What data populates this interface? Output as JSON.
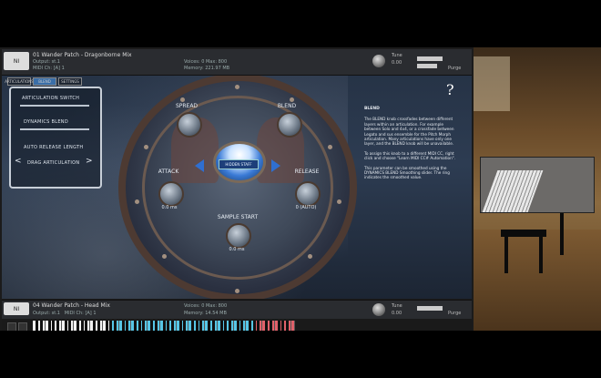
{
  "instrument_top": {
    "logo": "NI",
    "title": "01 Wander Patch - Dragonborne Mix",
    "output_label": "Output:",
    "output_value": "st.1",
    "midi_label": "MIDI Ch:",
    "midi_value": "[A] 1",
    "voices_label": "Voices:",
    "voices_value": "0",
    "max_label": "Max:",
    "max_value": "800",
    "memory_label": "Memory:",
    "memory_value": "221.97 MB",
    "tune_label": "Tune",
    "tune_value": "0.00",
    "purge_label": "Purge"
  },
  "tabs": [
    "ARTICULATIONS",
    "BLEND",
    "SETTINGS"
  ],
  "left_panel": {
    "title": "ARTICULATION SWITCH",
    "label2": "DYNAMICS BLEND",
    "label3": "AUTO RELEASE LENGTH",
    "label4": "DRAG ARTICULATION",
    "arrow_left": "<",
    "arrow_right": ">"
  },
  "shield": {
    "dial_top_left": "SPREAD",
    "dial_top_right": "BLEND",
    "dial_left": "ATTACK",
    "dial_left_value": "0.0 ms",
    "dial_right": "RELEASE",
    "dial_right_value": "0 (AUTO)",
    "dial_bottom": "SAMPLE START",
    "dial_bottom_value": "0.0 ms",
    "center_button": "HIDDEN STAFF"
  },
  "info": {
    "title": "BLEND",
    "p1": "The BLEND knob crossfades between different layers within an articulation. For example between Solo and 4x4, or a crossfade between Legato and sus ensemble for the Pitch Morph articulation. Many articulations have only one layer, and the BLEND knob will be unavailable.",
    "p2": "To assign this knob to a different MIDI CC, right click and choose \"Learn MIDI CC# Automation\".",
    "p3": "This parameter can be smoothed using the DYNAMICS BLEND Smoothing slider. The ring indicates the smoothed value.",
    "help": "?"
  },
  "instrument_bottom": {
    "logo": "NI",
    "title": "04 Wander Patch - Head Mix",
    "output_label": "Output:",
    "output_value": "st.1",
    "midi_label": "MIDI Ch:",
    "midi_value": "[A] 1",
    "voices_label": "Voices:",
    "voices_value": "0",
    "max_label": "Max:",
    "max_value": "800",
    "memory_label": "Memory:",
    "memory_value": "14.54 MB",
    "tune_label": "Tune",
    "tune_value": "0.00",
    "purge_label": "Purge"
  },
  "colors": {
    "keyswitch_blue": "#57c6e6",
    "keyswitch_red": "#e0616a",
    "white_key": "#f2f2f2"
  }
}
